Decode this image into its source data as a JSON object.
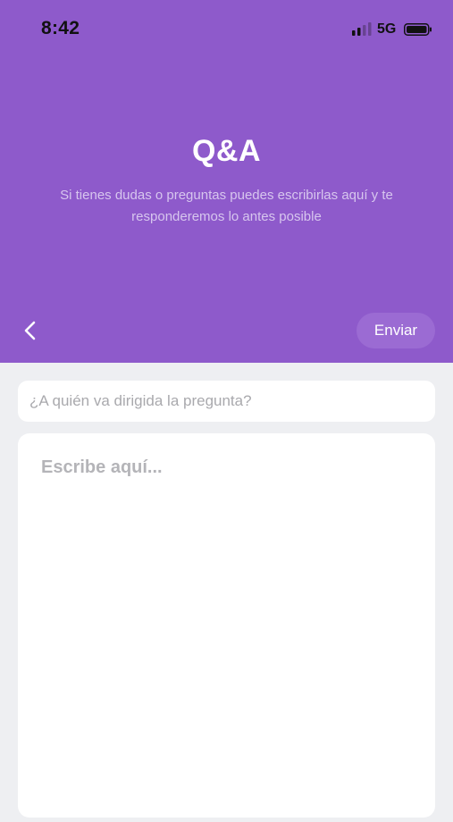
{
  "status_bar": {
    "time": "8:42",
    "network": "5G",
    "icons": [
      "signal-icon",
      "battery-icon"
    ]
  },
  "header": {
    "title": "Q&A",
    "subtitle": "Si tienes dudas o preguntas puedes escribirlas aquí y te responderemos lo antes posible",
    "back_icon": "chevron-left-icon",
    "send_label": "Enviar"
  },
  "form": {
    "recipient": {
      "placeholder": "¿A quién va dirigida la pregunta?",
      "value": ""
    },
    "message": {
      "placeholder": "Escribe aquí...",
      "value": ""
    }
  },
  "colors": {
    "header_bg": "#8e5acb",
    "send_button_bg": "#9b6bd3",
    "page_bg": "#eeeff2",
    "field_bg": "#ffffff"
  }
}
